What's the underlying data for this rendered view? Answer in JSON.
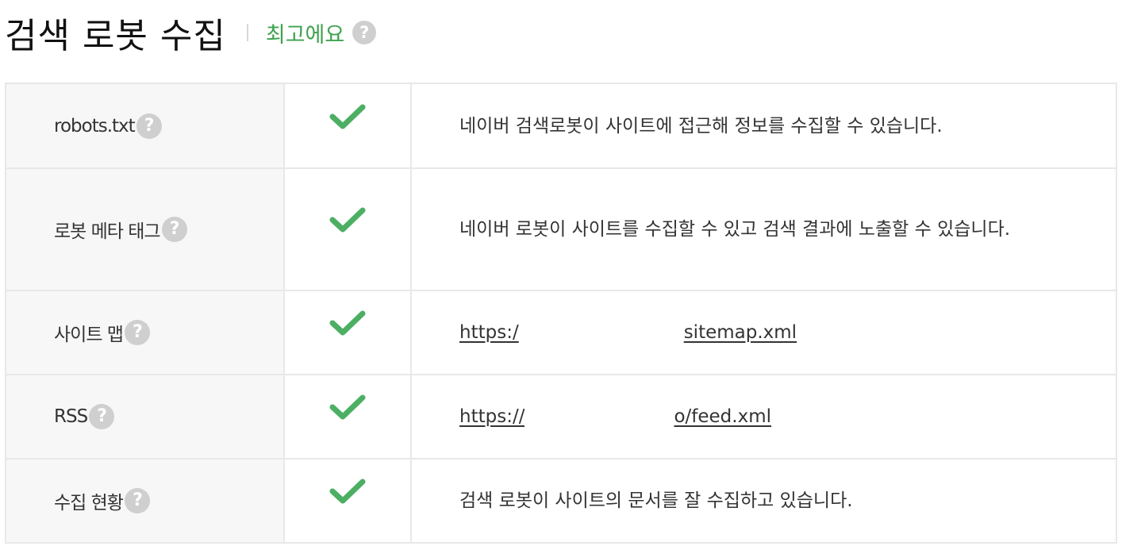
{
  "header": {
    "title": "검색 로봇 수집",
    "rating": "최고에요",
    "help_symbol": "?"
  },
  "colors": {
    "accent_green": "#3fa24f",
    "check_green": "#4caf63",
    "help_gray": "#cfcfcf"
  },
  "rows": [
    {
      "label": "robots.txt",
      "status_icon": "check-icon",
      "description": "네이버 검색로봇이 사이트에 접근해 정보를 수집할 수 있습니다."
    },
    {
      "label": "로봇 메타 태그",
      "status_icon": "check-icon",
      "description": "네이버 로봇이 사이트를 수집할 수 있고 검색 결과에 노출할 수 있습니다."
    },
    {
      "label": "사이트 맵",
      "status_icon": "check-icon",
      "link_start": "https:/",
      "link_end": "sitemap.xml"
    },
    {
      "label": "RSS",
      "status_icon": "check-icon",
      "link_start": "https://",
      "link_end": "o/feed.xml"
    },
    {
      "label": "수집 현황",
      "status_icon": "check-icon",
      "description": "검색 로봇이 사이트의 문서를 잘 수집하고 있습니다."
    }
  ]
}
